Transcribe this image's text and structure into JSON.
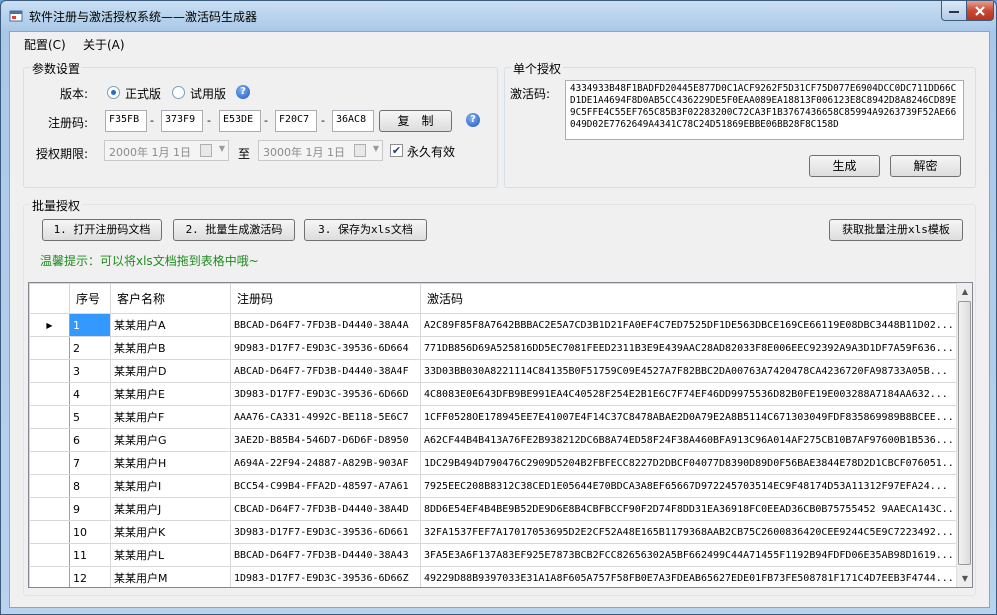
{
  "window": {
    "title": "软件注册与激活授权系统——激活码生成器"
  },
  "menu": [
    "配置(C)",
    "关于(A)"
  ],
  "params": {
    "group_title": "参数设置",
    "version_label": "版本:",
    "version_options": [
      "正式版",
      "试用版"
    ],
    "version_selected": "正式版",
    "regcode_label": "注册码:",
    "regcode_parts": [
      "F35FB",
      "373F9",
      "E53DE",
      "F20C7",
      "36AC8"
    ],
    "copy_label": "复　制",
    "period_label": "授权期限:",
    "date_from": "2000年 1月 1日",
    "to_label": "至",
    "date_to": "3000年 1月 1日",
    "forever_label": "永久有效",
    "forever_checked": true
  },
  "single": {
    "group_title": "单个授权",
    "code_label": "激活码:",
    "code_value": "4334933B48F1BADFD20445E877D0C1ACF9262F5D31CF75D077E6904DCC0DC711DD66CD1DE1A4694F8D0AB5CC436229DE5F0EAA089EA18813F006123E8C8942D8A8246CD89E9C5FFE4C55EF765C85B3F02283200C72CA3F1B3767436658C85994A9263739F52AE66049D02E7762649A4341C78C24D51869EBBE06BB28F8C158D",
    "generate_label": "生成",
    "decrypt_label": "解密"
  },
  "batch": {
    "group_title": "批量授权",
    "btn_open": "1. 打开注册码文档",
    "btn_generate": "2. 批量生成激活码",
    "btn_save": "3. 保存为xls文档",
    "btn_template": "获取批量注册xls模板",
    "tip": "温馨提示：可以将xls文档拖到表格中哦~"
  },
  "table": {
    "columns": [
      "序号",
      "客户名称",
      "注册码",
      "激活码"
    ],
    "rows": [
      [
        "1",
        "某某用户A",
        "BBCAD-D64F7-7FD3B-D4440-38A4A",
        "A2C89F85F8A7642BBBAC2E5A7CD3B1D21FA0EF4C7ED7525DF1DE563DBCE169CE66119E08DBC3448B11D02..."
      ],
      [
        "2",
        "某某用户B",
        "9D983-D17F7-E9D3C-39536-6D664",
        "771DB856D69A525816DD5EC7081FEED2311B3E9E439AAC28AD82033F8E006EEC92392A9A3D1DF7A59F636..."
      ],
      [
        "3",
        "某某用户D",
        "ABCAD-D64F7-7FD3B-D4440-38A4F",
        "33D03BB030A8221114C84135B0F51759C09E4527A7F82BBC2DA00763A7420478CA4236720FA98733A05B..."
      ],
      [
        "4",
        "某某用户E",
        "3D983-D17F7-E9D3C-39536-6D66D",
        "4C8083E0E643DFB9BE991EA4C40528F254E2B1E6C7F74EF46DD9975536D82B0FE19E003288A7184AA632..."
      ],
      [
        "5",
        "某某用户F",
        "AAA76-CA331-4992C-BE118-5E6C7",
        "1CFF0528OE178945EE7E41007E4F14C37C8478ABAE2D0A79E2A8B5114C671303049FDF835869989B8BCEE..."
      ],
      [
        "6",
        "某某用户G",
        "3AE2D-B85B4-546D7-D6D6F-D8950",
        "A62CF44B4B413A76FE2B938212DC6B8A74ED58F24F38A460BFA913C96A014AF275CB10B7AF97600B1B536..."
      ],
      [
        "7",
        "某某用户H",
        "A694A-22F94-24887-A829B-903AF",
        "1DC29B494D790476C2909D5204B2FBFECC8227D2DBCF04077D8390D89D0F56BAE3844E78D2D1CBCF076051..."
      ],
      [
        "8",
        "某某用户I",
        "BCC54-C99B4-FFA2D-48597-A7A61",
        "7925EEC208B8312C38CED1E05644E70BDCA3A8EF65667D972245703514EC9F48174D53A11312F97EFA24..."
      ],
      [
        "9",
        "某某用户J",
        "CBCAD-D64F7-7FD3B-D4440-38A4D",
        "8DD6E54EF4B4BE9B52DE9D6E8B4CBFBCCF90F2D74F8DD31EA36918FC0EEAD36CB0B75755452 9AAECA143C..."
      ],
      [
        "10",
        "某某用户K",
        "3D983-D17F7-E9D3C-39536-6D661",
        "32FA1537FEF7A17017053695D2E2CF52A48E165B1179368AAB2CB75C2600836420CEE9244C5E9C7223492..."
      ],
      [
        "11",
        "某某用户L",
        "BBCAD-D64F7-7FD3B-D4440-38A43",
        "3FA5E3A6F137A83EF925E7873BCB2FCC82656302A5BF662499C44A71455F1192B94FDFD06E35AB98D1619..."
      ],
      [
        "12",
        "某某用户M",
        "1D983-D17F7-E9D3C-39536-6D66Z",
        "49229D88B9397033E31A1A8F605A757F58FB0E7A3FDEAB65627EDE01FB73FE508781F171C4D7EEB3F4744..."
      ]
    ]
  }
}
